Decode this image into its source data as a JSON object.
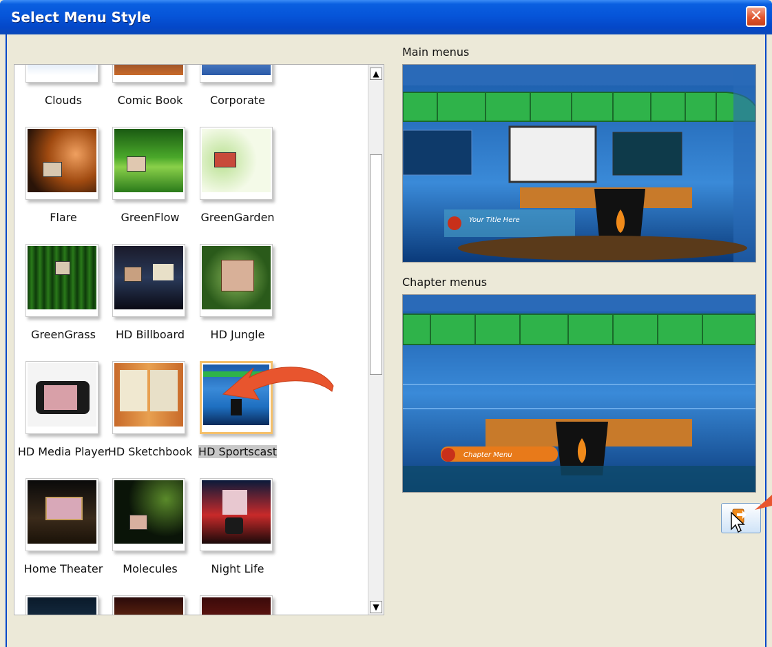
{
  "window": {
    "title": "Select Menu Style",
    "close_glyph": "✕"
  },
  "gallery": {
    "tiles": [
      {
        "label": "Clouds"
      },
      {
        "label": "Comic Book"
      },
      {
        "label": "Corporate"
      },
      {
        "label": "Flare"
      },
      {
        "label": "GreenFlow"
      },
      {
        "label": "GreenGarden"
      },
      {
        "label": "GreenGrass"
      },
      {
        "label": "HD Billboard"
      },
      {
        "label": "HD Jungle"
      },
      {
        "label": "HD Media Player"
      },
      {
        "label": "HD Sketchbook"
      },
      {
        "label": "HD Sportscast"
      },
      {
        "label": "Home Theater"
      },
      {
        "label": "Molecules"
      },
      {
        "label": "Night Life"
      }
    ],
    "selected": "HD Sportscast"
  },
  "scrollbar": {
    "up_glyph": "▲",
    "down_glyph": "▼"
  },
  "preview": {
    "main_label": "Main menus",
    "main_overlay": "Your Title Here",
    "chapter_label": "Chapter menus",
    "chapter_overlay": "Chapter Menu"
  },
  "colors": {
    "title_bar": "#0655d9",
    "accent_orange": "#e8552e",
    "selection_border": "#f5c06a",
    "studio_green": "#2fb34a",
    "studio_blue": "#1e6fc0"
  },
  "icons": {
    "close": "close-icon",
    "scroll_up": "arrow-up-icon",
    "scroll_down": "arrow-down-icon",
    "apply": "apply-to-chapters-icon",
    "cursor": "mouse-pointer-icon"
  }
}
